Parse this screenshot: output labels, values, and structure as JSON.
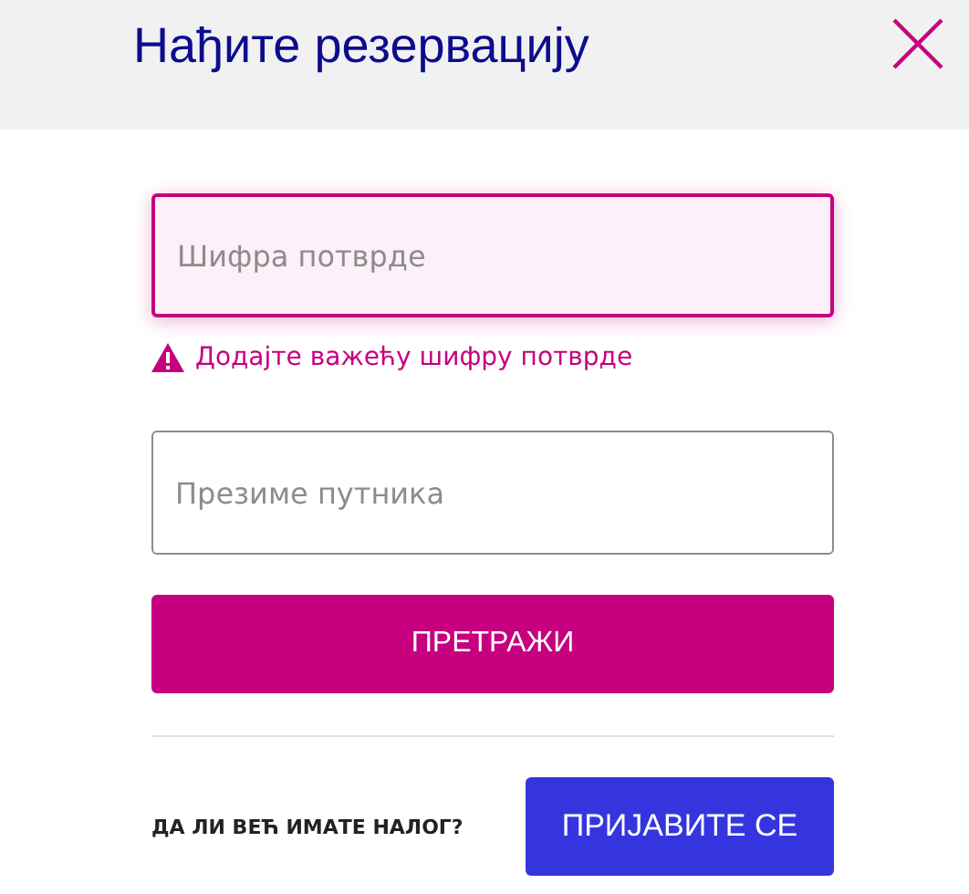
{
  "header": {
    "title": "Нађите резервацију"
  },
  "fields": [
    {
      "placeholder": "Шифра потврде",
      "invalid": true,
      "error": "Додајте важећу шифру потврде"
    },
    {
      "placeholder": "Презиме путника",
      "invalid": false
    }
  ],
  "search_button": "ПРЕТРАЖИ",
  "account": {
    "question": "ДА ЛИ ВЕЋ ИМАТЕ НАЛОГ?",
    "login_button": "ПРИЈАВИТЕ СЕ"
  }
}
